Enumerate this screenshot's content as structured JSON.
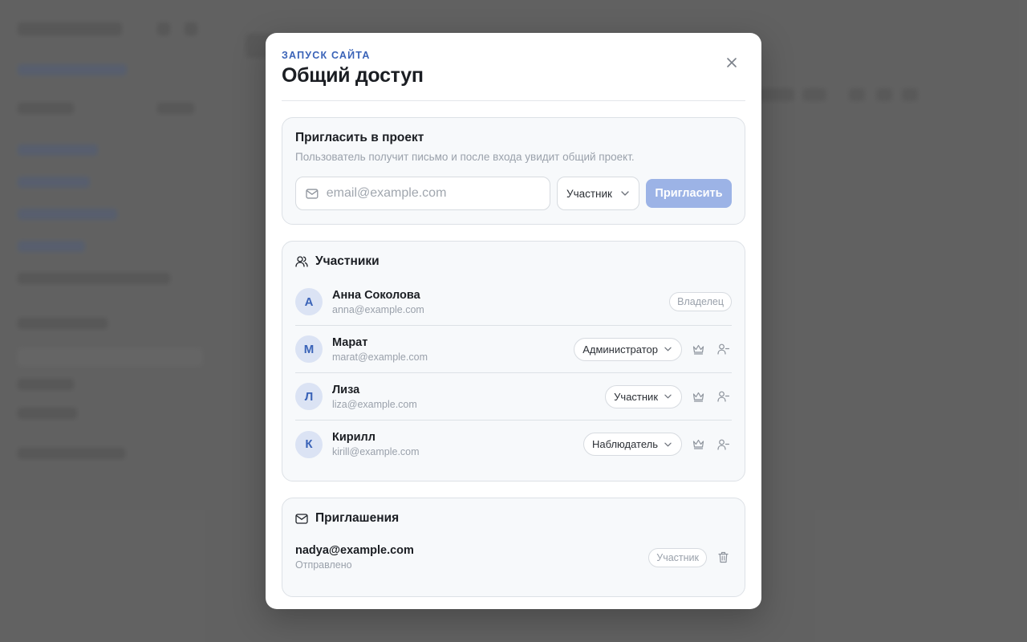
{
  "modal": {
    "eyebrow": "ЗАПУСК САЙТА",
    "title": "Общий доступ"
  },
  "invite": {
    "title": "Пригласить в проект",
    "subtitle": "Пользователь получит письмо и после входа увидит общий проект.",
    "email_placeholder": "email@example.com",
    "role_value": "Участник",
    "button_label": "Пригласить"
  },
  "members": {
    "title": "Участники",
    "owner_badge": "Владелец",
    "list": [
      {
        "initial": "А",
        "name": "Анна Соколова",
        "email": "anna@example.com"
      },
      {
        "initial": "М",
        "name": "Марат",
        "email": "marat@example.com",
        "role": "Администратор"
      },
      {
        "initial": "Л",
        "name": "Лиза",
        "email": "liza@example.com",
        "role": "Участник"
      },
      {
        "initial": "К",
        "name": "Кирилл",
        "email": "kirill@example.com",
        "role": "Наблюдатель"
      }
    ]
  },
  "invitations": {
    "title": "Приглашения",
    "list": [
      {
        "email": "nadya@example.com",
        "status": "Отправлено",
        "role": "Участник"
      }
    ]
  },
  "colors": {
    "accent": "#3a63b8",
    "invite_button_disabled": "#9cb3e6",
    "avatar_bg": "#dbe3f4"
  }
}
